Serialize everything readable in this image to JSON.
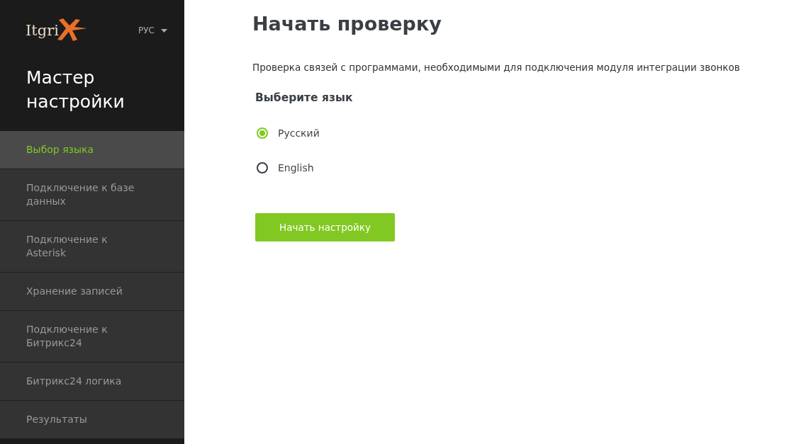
{
  "sidebar": {
    "logo": "Itgri",
    "language": "РУС",
    "title": "Мастер настройки",
    "items": [
      {
        "label": "Выбор языка",
        "selected": true
      },
      {
        "label": "Подключение к базе данных",
        "selected": false
      },
      {
        "label": "Подключение к Asterisk",
        "selected": false
      },
      {
        "label": "Хранение записей",
        "selected": false
      },
      {
        "label": "Подключение к Битрикс24",
        "selected": false
      },
      {
        "label": "Битрикс24 логика",
        "selected": false
      },
      {
        "label": "Результаты",
        "selected": false
      }
    ]
  },
  "main": {
    "title": "Начать проверку",
    "description": "Проверка связей с программами, необходимыми для подключения модуля интеграции звонков",
    "language_heading": "Выберите язык",
    "options": [
      {
        "label": "Русский",
        "selected": true
      },
      {
        "label": "English",
        "selected": false
      }
    ],
    "button": "Начать настройку"
  }
}
